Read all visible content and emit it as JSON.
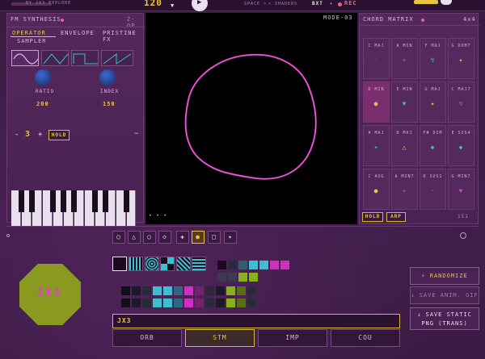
{
  "topbar": {
    "tempo": "120",
    "subtitle": "BY JX3 EXPLORE",
    "label_a": "SPACE >",
    "label_b": "> SHADERS",
    "drop_val": "BXT",
    "rec": "REC"
  },
  "synth": {
    "title": "FM SYNTHESIS",
    "mode": "2-OP",
    "tabs": [
      "OPERATOR",
      "ENVELOPE",
      "PRISTINE FX",
      "SAMPLER"
    ],
    "ratio_label": "RATIO",
    "ratio_value": "200",
    "index_label": "INDEX",
    "index_value": "150",
    "minus": "-",
    "octave": "3",
    "plus": "+",
    "hold": "HOLD",
    "collapse": "−"
  },
  "viz": {
    "mode_label": "MODE-03",
    "dots": "• • •"
  },
  "chord": {
    "title": "CHORD MATRIX",
    "size": "4x4",
    "cells": [
      {
        "label": "C MAJ",
        "glyph": "·",
        "color": "#b03ab0"
      },
      {
        "label": "A MIN",
        "glyph": "+",
        "color": "#c050c0"
      },
      {
        "label": "F MAJ",
        "glyph": "↯",
        "color": "#3ac0d0"
      },
      {
        "label": "G DOM7",
        "glyph": "✦",
        "color": "#e8c640"
      },
      {
        "label": "D MIN",
        "glyph": "●",
        "color": "#e8c640"
      },
      {
        "label": "E MIN",
        "glyph": "▼",
        "color": "#3ac0d0"
      },
      {
        "label": "G MAJ",
        "glyph": "✦",
        "color": "#e8c640"
      },
      {
        "label": "C MAJ7",
        "glyph": "↯",
        "color": "#c050c0"
      },
      {
        "label": "A MAJ",
        "glyph": "✦",
        "color": "#3ac0d0"
      },
      {
        "label": "D MAJ",
        "glyph": "△",
        "color": "#e8c640"
      },
      {
        "label": "F# DIM",
        "glyph": "◆",
        "color": "#3ac0d0"
      },
      {
        "label": "E SUS4",
        "glyph": "◆",
        "color": "#3ac0d0"
      },
      {
        "label": "C AUG",
        "glyph": "●",
        "color": "#e8c640"
      },
      {
        "label": "A MIN7",
        "glyph": "+",
        "color": "#c050c0"
      },
      {
        "label": "D SUS2",
        "glyph": "·",
        "color": "#c050c0"
      },
      {
        "label": "G MIN7",
        "glyph": "▼",
        "color": "#c050c0"
      }
    ],
    "hold": "HOLD",
    "arp": "ARP",
    "corner": "151"
  },
  "shapes": [
    "○",
    "△",
    "○",
    "◇",
    "✚",
    "●",
    "□",
    "✦"
  ],
  "logo_text": "JX3",
  "text_input": "JX3",
  "buttons": {
    "randomize": "⚡ RANDOMIZE",
    "save_gif": "↓ SAVE ANIM. GIF",
    "save_png": "↓ SAVE STATIC PNG (TRANS)"
  },
  "tabs": [
    "ORB",
    "STM",
    "IMP",
    "COU"
  ],
  "colors": {
    "accent": "#e8c640",
    "magenta": "#d030c0",
    "cyan": "#3ac0d0",
    "lime": "#8ab020"
  }
}
